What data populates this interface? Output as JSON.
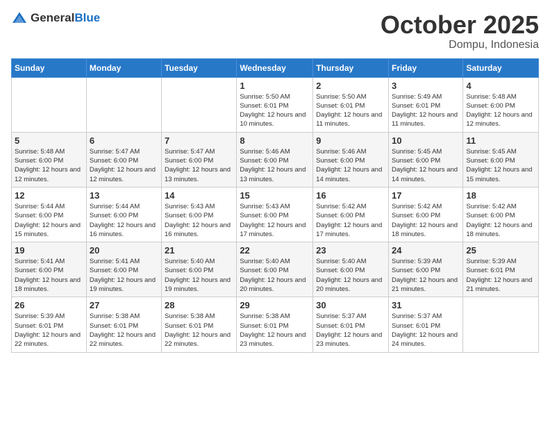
{
  "header": {
    "logo": {
      "general": "General",
      "blue": "Blue"
    },
    "month": "October 2025",
    "location": "Dompu, Indonesia"
  },
  "weekdays": [
    "Sunday",
    "Monday",
    "Tuesday",
    "Wednesday",
    "Thursday",
    "Friday",
    "Saturday"
  ],
  "weeks": [
    [
      {
        "day": "",
        "info": ""
      },
      {
        "day": "",
        "info": ""
      },
      {
        "day": "",
        "info": ""
      },
      {
        "day": "1",
        "info": "Sunrise: 5:50 AM\nSunset: 6:01 PM\nDaylight: 12 hours and 10 minutes."
      },
      {
        "day": "2",
        "info": "Sunrise: 5:50 AM\nSunset: 6:01 PM\nDaylight: 12 hours and 11 minutes."
      },
      {
        "day": "3",
        "info": "Sunrise: 5:49 AM\nSunset: 6:01 PM\nDaylight: 12 hours and 11 minutes."
      },
      {
        "day": "4",
        "info": "Sunrise: 5:48 AM\nSunset: 6:00 PM\nDaylight: 12 hours and 12 minutes."
      }
    ],
    [
      {
        "day": "5",
        "info": "Sunrise: 5:48 AM\nSunset: 6:00 PM\nDaylight: 12 hours and 12 minutes."
      },
      {
        "day": "6",
        "info": "Sunrise: 5:47 AM\nSunset: 6:00 PM\nDaylight: 12 hours and 12 minutes."
      },
      {
        "day": "7",
        "info": "Sunrise: 5:47 AM\nSunset: 6:00 PM\nDaylight: 12 hours and 13 minutes."
      },
      {
        "day": "8",
        "info": "Sunrise: 5:46 AM\nSunset: 6:00 PM\nDaylight: 12 hours and 13 minutes."
      },
      {
        "day": "9",
        "info": "Sunrise: 5:46 AM\nSunset: 6:00 PM\nDaylight: 12 hours and 14 minutes."
      },
      {
        "day": "10",
        "info": "Sunrise: 5:45 AM\nSunset: 6:00 PM\nDaylight: 12 hours and 14 minutes."
      },
      {
        "day": "11",
        "info": "Sunrise: 5:45 AM\nSunset: 6:00 PM\nDaylight: 12 hours and 15 minutes."
      }
    ],
    [
      {
        "day": "12",
        "info": "Sunrise: 5:44 AM\nSunset: 6:00 PM\nDaylight: 12 hours and 15 minutes."
      },
      {
        "day": "13",
        "info": "Sunrise: 5:44 AM\nSunset: 6:00 PM\nDaylight: 12 hours and 16 minutes."
      },
      {
        "day": "14",
        "info": "Sunrise: 5:43 AM\nSunset: 6:00 PM\nDaylight: 12 hours and 16 minutes."
      },
      {
        "day": "15",
        "info": "Sunrise: 5:43 AM\nSunset: 6:00 PM\nDaylight: 12 hours and 17 minutes."
      },
      {
        "day": "16",
        "info": "Sunrise: 5:42 AM\nSunset: 6:00 PM\nDaylight: 12 hours and 17 minutes."
      },
      {
        "day": "17",
        "info": "Sunrise: 5:42 AM\nSunset: 6:00 PM\nDaylight: 12 hours and 18 minutes."
      },
      {
        "day": "18",
        "info": "Sunrise: 5:42 AM\nSunset: 6:00 PM\nDaylight: 12 hours and 18 minutes."
      }
    ],
    [
      {
        "day": "19",
        "info": "Sunrise: 5:41 AM\nSunset: 6:00 PM\nDaylight: 12 hours and 18 minutes."
      },
      {
        "day": "20",
        "info": "Sunrise: 5:41 AM\nSunset: 6:00 PM\nDaylight: 12 hours and 19 minutes."
      },
      {
        "day": "21",
        "info": "Sunrise: 5:40 AM\nSunset: 6:00 PM\nDaylight: 12 hours and 19 minutes."
      },
      {
        "day": "22",
        "info": "Sunrise: 5:40 AM\nSunset: 6:00 PM\nDaylight: 12 hours and 20 minutes."
      },
      {
        "day": "23",
        "info": "Sunrise: 5:40 AM\nSunset: 6:00 PM\nDaylight: 12 hours and 20 minutes."
      },
      {
        "day": "24",
        "info": "Sunrise: 5:39 AM\nSunset: 6:00 PM\nDaylight: 12 hours and 21 minutes."
      },
      {
        "day": "25",
        "info": "Sunrise: 5:39 AM\nSunset: 6:01 PM\nDaylight: 12 hours and 21 minutes."
      }
    ],
    [
      {
        "day": "26",
        "info": "Sunrise: 5:39 AM\nSunset: 6:01 PM\nDaylight: 12 hours and 22 minutes."
      },
      {
        "day": "27",
        "info": "Sunrise: 5:38 AM\nSunset: 6:01 PM\nDaylight: 12 hours and 22 minutes."
      },
      {
        "day": "28",
        "info": "Sunrise: 5:38 AM\nSunset: 6:01 PM\nDaylight: 12 hours and 22 minutes."
      },
      {
        "day": "29",
        "info": "Sunrise: 5:38 AM\nSunset: 6:01 PM\nDaylight: 12 hours and 23 minutes."
      },
      {
        "day": "30",
        "info": "Sunrise: 5:37 AM\nSunset: 6:01 PM\nDaylight: 12 hours and 23 minutes."
      },
      {
        "day": "31",
        "info": "Sunrise: 5:37 AM\nSunset: 6:01 PM\nDaylight: 12 hours and 24 minutes."
      },
      {
        "day": "",
        "info": ""
      }
    ]
  ]
}
